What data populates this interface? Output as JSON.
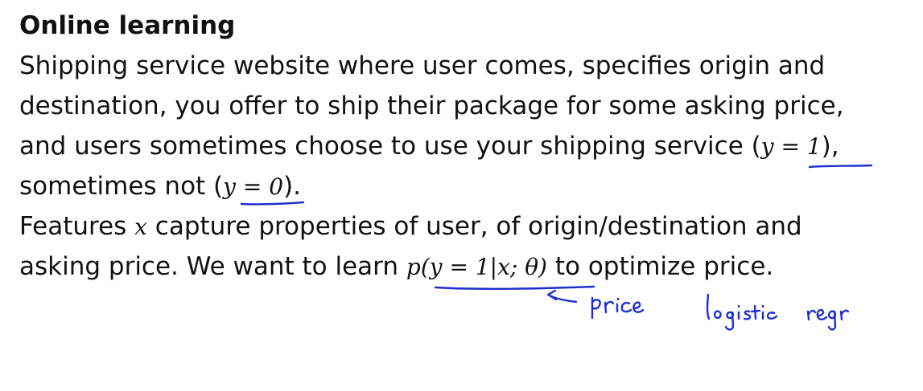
{
  "slide": {
    "title": "Online learning",
    "lines": [
      {
        "text": "Shipping service website where user comes, specifies origin and"
      },
      {
        "text": "destination, you offer to ship their package for some asking price,"
      },
      {
        "before": "and users sometimes choose to use your shipping service (",
        "math": "y = 1",
        "after": "),"
      },
      {
        "before": "sometimes not (",
        "math": "y = 0",
        "after": ")."
      },
      {
        "before": "Features ",
        "math": "x",
        "after": " capture properties of user, of origin/destination and"
      },
      {
        "before": "asking price. We want to learn ",
        "math": "p(y = 1|x; θ)",
        "after": " to optimize price."
      }
    ]
  },
  "annotations": {
    "handwritten_1": "price",
    "handwritten_2": "logistic regr",
    "ink_color": "#1f2fd0"
  }
}
